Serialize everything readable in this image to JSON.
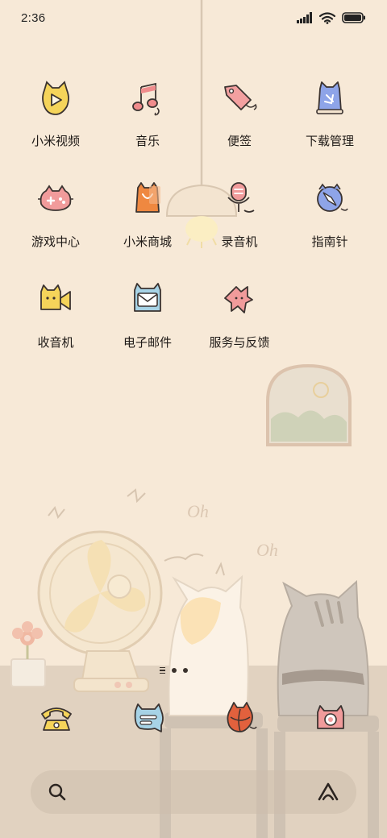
{
  "status_bar": {
    "time": "2:36",
    "battery_level": 1.0,
    "wifi": "wifi-icon",
    "signal": "signal-icon"
  },
  "apps": [
    {
      "label": "小米视频",
      "icon": "video-cat-icon",
      "color": "#f5d45a"
    },
    {
      "label": "音乐",
      "icon": "music-note-icon",
      "color": "#f08c8c"
    },
    {
      "label": "便签",
      "icon": "note-tag-icon",
      "color": "#f3a0a0"
    },
    {
      "label": "下载管理",
      "icon": "download-bag-icon",
      "color": "#8ea4e8"
    },
    {
      "label": "游戏中心",
      "icon": "gamepad-icon",
      "color": "#f19b9b"
    },
    {
      "label": "小米商城",
      "icon": "shopping-bag-icon",
      "color": "#ef8840"
    },
    {
      "label": "录音机",
      "icon": "microphone-icon",
      "color": "#f19b9b"
    },
    {
      "label": "指南针",
      "icon": "compass-icon",
      "color": "#8ea4e8"
    },
    {
      "label": "收音机",
      "icon": "radio-camera-icon",
      "color": "#f5d45a"
    },
    {
      "label": "电子邮件",
      "icon": "mail-icon",
      "color": "#a7d3e6"
    },
    {
      "label": "服务与反馈",
      "icon": "service-feedback-icon",
      "color": "#f19b9b"
    }
  ],
  "dock": [
    {
      "name": "phone",
      "icon": "telephone-icon",
      "color": "#f5d45a"
    },
    {
      "name": "messages",
      "icon": "message-icon",
      "color": "#a7d3e6"
    },
    {
      "name": "browser",
      "icon": "browser-ball-icon",
      "color": "#e2613d"
    },
    {
      "name": "camera",
      "icon": "camera-icon",
      "color": "#f19b9b"
    }
  ],
  "page_indicator": {
    "pages": 2,
    "current": 1
  },
  "search": {
    "left_icon": "search-icon",
    "right_icon": "assistant-icon"
  },
  "wallpaper": {
    "theme": "cats-on-stools",
    "words": [
      "Oh",
      "Oh"
    ],
    "background": "#f6e8d6",
    "floor": "#e0d2c1"
  }
}
